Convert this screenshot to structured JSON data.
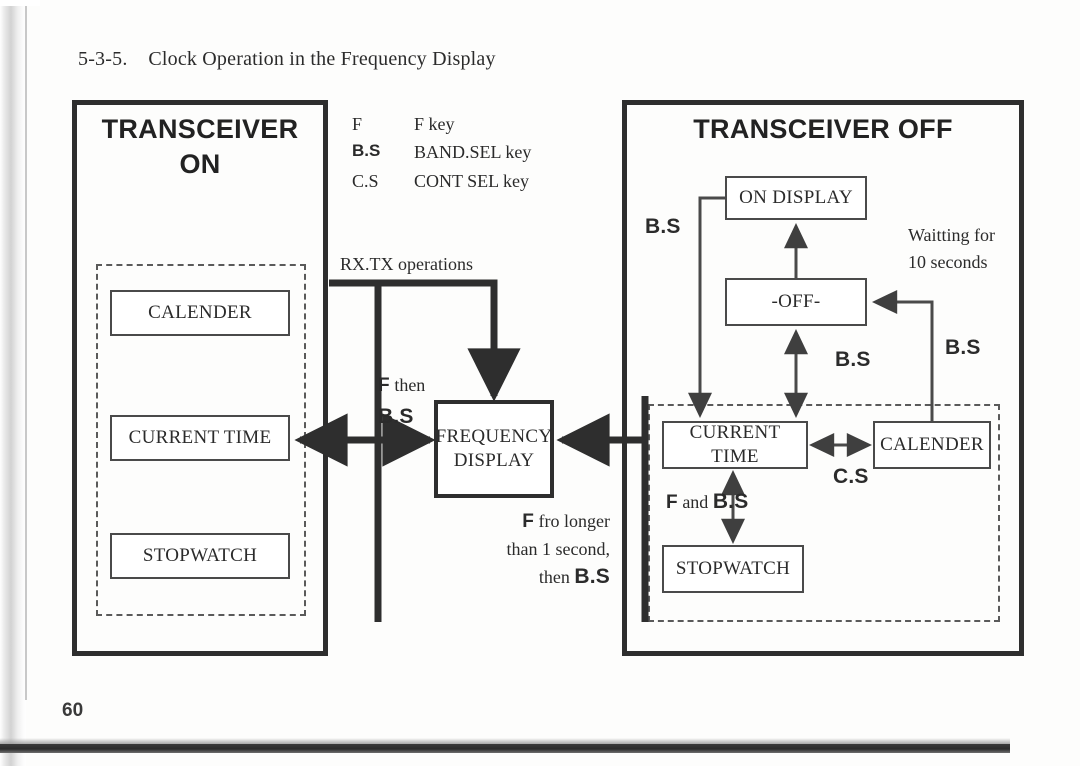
{
  "document": {
    "section_number": "5-3-5.",
    "section_title": "Clock Operation in the Frequency Display",
    "heading_full": "5-3-5.    Clock Operation in the Frequency Display",
    "page_number": "60"
  },
  "legend": {
    "rows": [
      {
        "key": "F",
        "key_bold": false,
        "description": "F key"
      },
      {
        "key": "B.S",
        "key_bold": true,
        "description": "BAND.SEL key"
      },
      {
        "key": "C.S",
        "key_bold": false,
        "description": "CONT SEL key"
      }
    ]
  },
  "panels": {
    "transceiver_on": {
      "title_line1": "TRANSCEIVER",
      "title_line2": "ON",
      "states": [
        {
          "id": "calender",
          "label": "CALENDER"
        },
        {
          "id": "current-time",
          "label": "CURRENT TIME"
        },
        {
          "id": "stopwatch",
          "label": "STOPWATCH"
        }
      ]
    },
    "transceiver_off": {
      "title": "TRANSCEIVER OFF",
      "outside_states": [
        {
          "id": "on-display",
          "label": "ON DISPLAY"
        },
        {
          "id": "off",
          "label": "-OFF-"
        }
      ],
      "states": [
        {
          "id": "current-time",
          "label": "CURRENT TIME"
        },
        {
          "id": "calender",
          "label": "CALENDER"
        },
        {
          "id": "stopwatch",
          "label": "STOPWATCH"
        }
      ]
    }
  },
  "center": {
    "frequency_display_line1": "FREQUENCY",
    "frequency_display_line2": "DISPLAY"
  },
  "transition_labels": {
    "rx_tx": "RX.TX operations",
    "f_then_bs": {
      "key1": "F",
      "word": "then",
      "key2": "B.S"
    },
    "f_longer": {
      "key1": "F",
      "line1_rest": "fro longer",
      "line2": "than 1 second,",
      "line3_word": "then",
      "key2": "B.S"
    },
    "bs_on_display": "B.S",
    "waitting": {
      "line1": "Waitting for",
      "line2": "10 seconds"
    },
    "bs_off_current_time": "B.S",
    "bs_calender_off": "B.S",
    "cs": "C.S",
    "f_and_bs": {
      "key1": "F",
      "word": "and",
      "key2": "B.S"
    }
  },
  "colors": {
    "ink": "#2b2b2b",
    "heavy_line": "#2e2e2e",
    "thin_line": "#4a4a4a",
    "dashed_line": "#5a5a5a",
    "page_background": "#fdfdfc"
  }
}
